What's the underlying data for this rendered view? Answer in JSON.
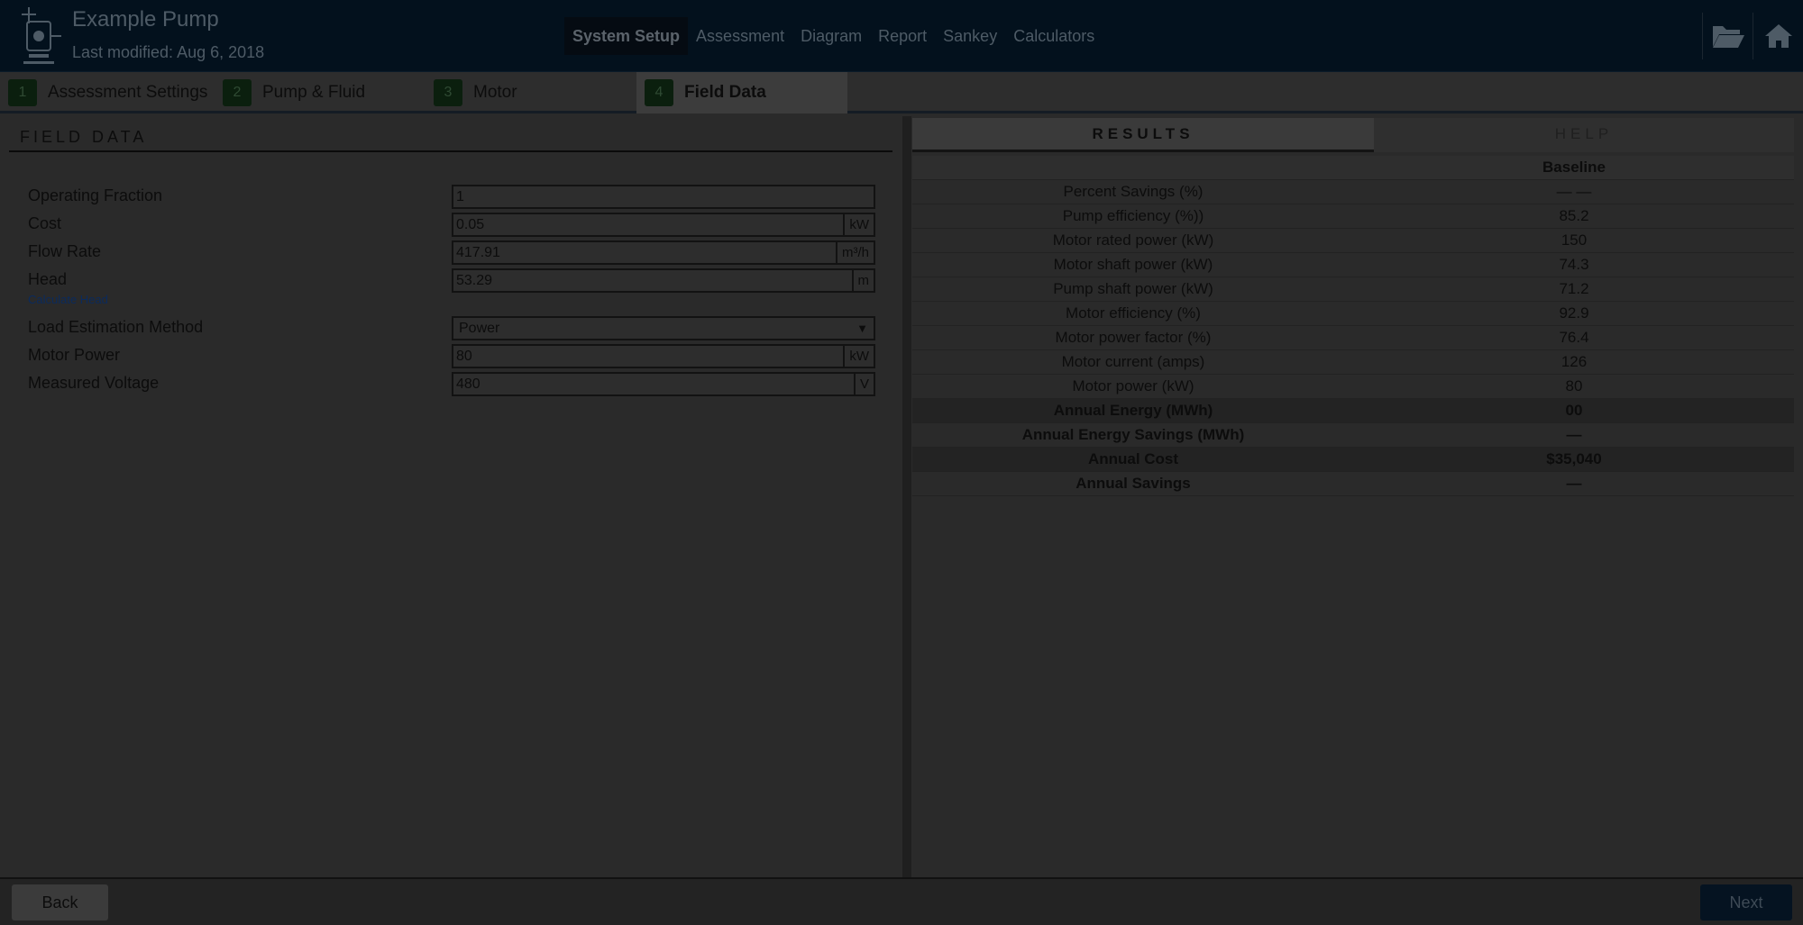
{
  "header": {
    "title": "Example Pump",
    "subtitle": "Last modified: Aug 6, 2018",
    "nav": [
      {
        "label": "System Setup",
        "active": true
      },
      {
        "label": "Assessment"
      },
      {
        "label": "Diagram"
      },
      {
        "label": "Report"
      },
      {
        "label": "Sankey"
      },
      {
        "label": "Calculators"
      }
    ],
    "icons": [
      "folder-open-icon",
      "home-icon"
    ]
  },
  "steps": [
    {
      "num": "1",
      "label": "Assessment Settings"
    },
    {
      "num": "2",
      "label": "Pump & Fluid"
    },
    {
      "num": "3",
      "label": "Motor"
    },
    {
      "num": "4",
      "label": "Field Data",
      "active": true
    }
  ],
  "field_data": {
    "heading": "FIELD DATA",
    "fields": [
      {
        "label": "Operating Fraction",
        "value": "1",
        "unit": ""
      },
      {
        "label": "Cost",
        "value": "0.05",
        "unit": "kW"
      },
      {
        "label": "Flow Rate",
        "value": "417.91",
        "unit": "m³/h"
      },
      {
        "label": "Head",
        "value": "53.29",
        "unit": "m",
        "link": "Calculate Head"
      },
      {
        "label": "Load Estimation Method",
        "value": "Power",
        "unit": "",
        "select": true
      },
      {
        "label": "Motor Power",
        "value": "80",
        "unit": "kW"
      },
      {
        "label": "Measured Voltage",
        "value": "480",
        "unit": "V"
      }
    ]
  },
  "results": {
    "tabs": [
      {
        "label": "RESULTS",
        "active": true
      },
      {
        "label": "HELP"
      }
    ],
    "column_header": "Baseline",
    "rows": [
      {
        "label": "Percent Savings (%)",
        "value": "— —"
      },
      {
        "label": "Pump efficiency (%))",
        "value": "85.2"
      },
      {
        "label": "Motor rated power (kW)",
        "value": "150"
      },
      {
        "label": "Motor shaft power (kW)",
        "value": "74.3"
      },
      {
        "label": "Pump shaft power (kW)",
        "value": "71.2"
      },
      {
        "label": "Motor efficiency (%)",
        "value": "92.9"
      },
      {
        "label": "Motor power factor (%)",
        "value": "76.4"
      },
      {
        "label": "Motor current (amps)",
        "value": "126"
      },
      {
        "label": "Motor power (kW)",
        "value": "80"
      },
      {
        "label": "Annual Energy (MWh)",
        "value": "00",
        "style": "shade"
      },
      {
        "label": "Annual Energy Savings (MWh)",
        "value": "—",
        "style": "bold"
      },
      {
        "label": "Annual Cost",
        "value": "$35,040",
        "style": "shade"
      },
      {
        "label": "Annual Savings",
        "value": "—",
        "style": "bold"
      }
    ]
  },
  "footer": {
    "back_label": "Back",
    "next_label": "Next"
  }
}
